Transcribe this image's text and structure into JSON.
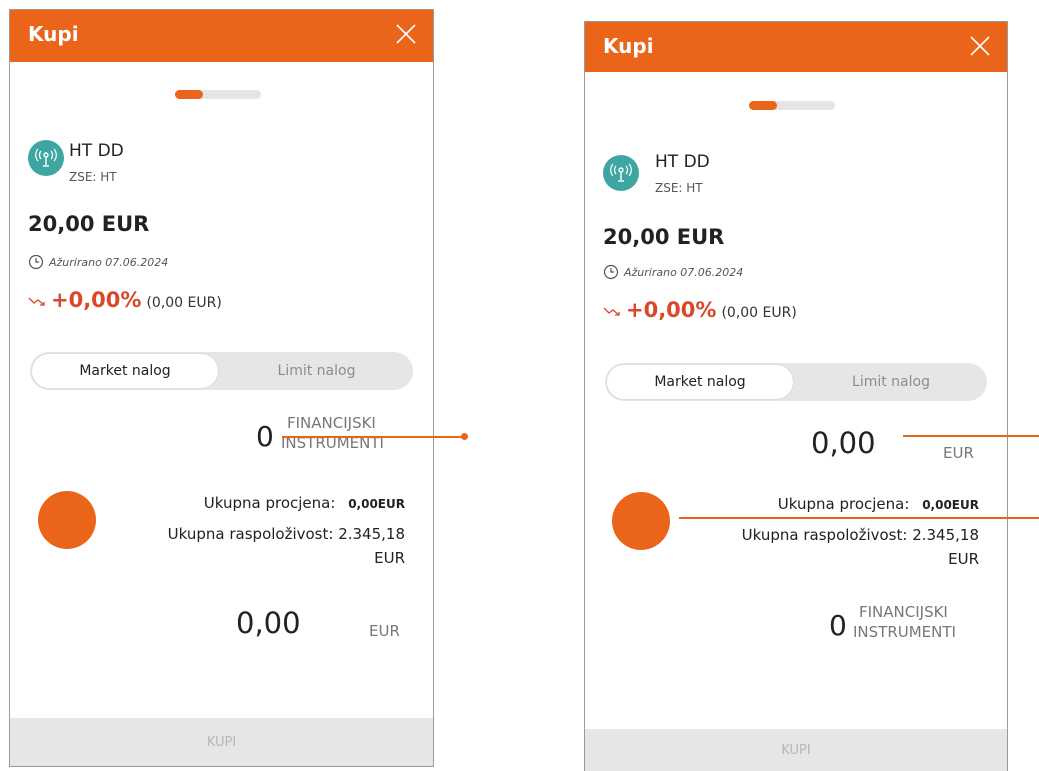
{
  "screens": [
    {
      "header": {
        "title": "Kupi"
      },
      "progress": {
        "value": 0.33
      },
      "stock": {
        "name": "HT DD",
        "exchange": "ZSE: HT"
      },
      "price": "20,00 EUR",
      "updated": "Ažurirano 07.06.2024",
      "change": {
        "percent": "+0,00%",
        "absolute": "(0,00 EUR)"
      },
      "order_types": {
        "market": "Market nalog",
        "limit": "Limit nalog",
        "selected": "market"
      },
      "quantity": {
        "value": "0",
        "unit_line1": "FINANCIJSKI",
        "unit_line2": "INSTRUMENTI"
      },
      "summary": {
        "estimate_label": "Ukupna procjena:",
        "estimate_value": "0,00EUR",
        "availability_label": "Ukupna raspoloživost: 2.345,18",
        "availability_unit": "EUR"
      },
      "amount": {
        "value": "0,00",
        "unit": "EUR"
      },
      "buy_button": "KUPI"
    },
    {
      "header": {
        "title": "Kupi"
      },
      "progress": {
        "value": 0.33
      },
      "stock": {
        "name": "HT DD",
        "exchange": "ZSE: HT"
      },
      "price": "20,00 EUR",
      "updated": "Ažurirano 07.06.2024",
      "change": {
        "percent": "+0,00%",
        "absolute": "(0,00 EUR)"
      },
      "order_types": {
        "market": "Market nalog",
        "limit": "Limit nalog",
        "selected": "market"
      },
      "amount": {
        "value": "0,00",
        "unit": "EUR"
      },
      "summary": {
        "estimate_label": "Ukupna procjena:",
        "estimate_value": "0,00EUR",
        "availability_label": "Ukupna raspoloživost: 2.345,18",
        "availability_unit": "EUR"
      },
      "quantity": {
        "value": "0",
        "unit_line1": "FINANCIJSKI",
        "unit_line2": "INSTRUMENTI"
      },
      "buy_button": "KUPI"
    }
  ],
  "colors": {
    "accent": "#ea6419",
    "negative_change": "#d9482b",
    "logo_bg": "#3ea6a1"
  },
  "icons": [
    "close-icon",
    "antenna-icon",
    "clock-icon",
    "trend-icon"
  ]
}
